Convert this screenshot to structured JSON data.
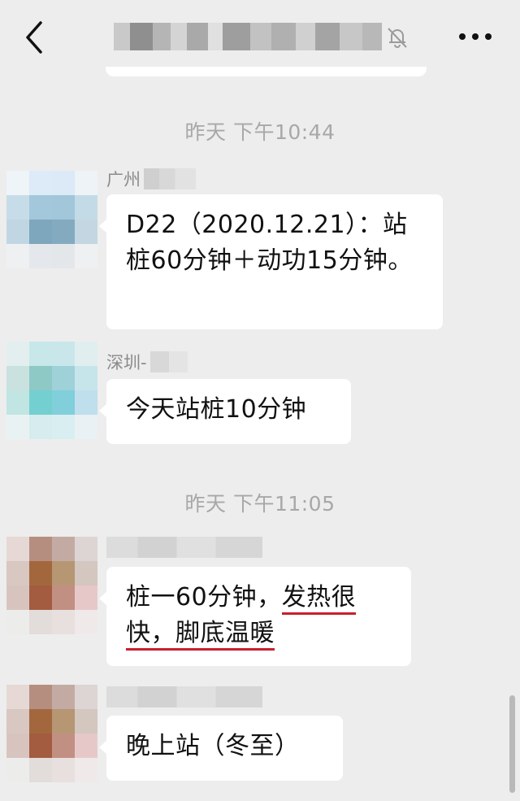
{
  "header": {
    "back_icon": "chevron-left-icon",
    "title_blurred": true,
    "mute_icon": "bell-muted-icon",
    "more_icon": "more-dots-icon"
  },
  "timestamps": [
    "昨天 下午10:44",
    "昨天 下午11:05"
  ],
  "messages": [
    {
      "sender": "广州",
      "text": "D22（2020.12.21）：站桩60分钟＋动功15分钟。"
    },
    {
      "sender": "深圳-",
      "text": "今天站桩10分钟"
    },
    {
      "sender": "",
      "text_plain": "桩一60分钟，",
      "text_underlined_1": "发热很",
      "text_underlined_2": "快，脚底温暖"
    },
    {
      "sender": "",
      "text": "晚上站（冬至）"
    }
  ],
  "colors": {
    "background": "#ededed",
    "bubble": "#ffffff",
    "timestamp": "#a8a8a8",
    "underline": "#c8202c"
  }
}
